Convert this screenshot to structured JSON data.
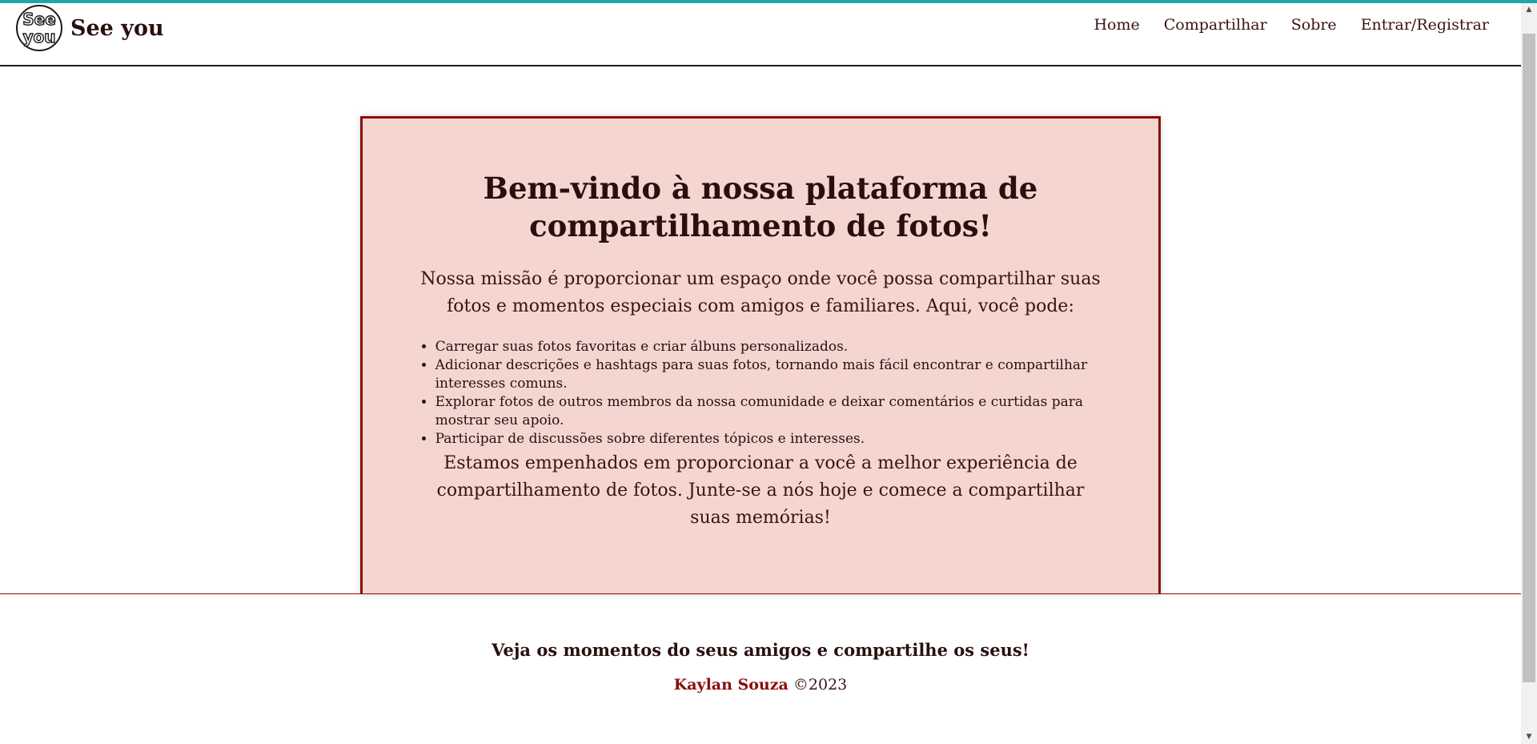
{
  "brand": {
    "name": "See you",
    "logo_text_top": "See",
    "logo_text_bottom": "you"
  },
  "nav": {
    "items": [
      "Home",
      "Compartilhar",
      "Sobre",
      "Entrar/Registrar"
    ]
  },
  "colors": {
    "accent_bar": "#1fa7a7",
    "card_bg": "#f4d5d0",
    "card_border": "#8b0d0d",
    "text": "#3a1212"
  },
  "main": {
    "title": "Bem-vindo à nossa plataforma de compartilhamento de fotos!",
    "intro": "Nossa missão é proporcionar um espaço onde você possa compartilhar suas fotos e momentos especiais com amigos e familiares. Aqui, você pode:",
    "features": [
      "Carregar suas fotos favoritas e criar álbuns personalizados.",
      "Adicionar descrições e hashtags para suas fotos, tornando mais fácil encontrar e compartilhar interesses comuns.",
      "Explorar fotos de outros membros da nossa comunidade e deixar comentários e curtidas para mostrar seu apoio.",
      "Participar de discussões sobre diferentes tópicos e interesses."
    ],
    "outro": "Estamos empenhados em proporcionar a você a melhor experiência de compartilhamento de fotos. Junte-se a nós hoje e comece a compartilhar suas memórias!"
  },
  "footer": {
    "tagline": "Veja os momentos do seus amigos e compartilhe os seus!",
    "author": "Kaylan Souza",
    "copyright": "©2023"
  },
  "scrollbar": {
    "up_arrow": "▲",
    "down_arrow": "▼"
  }
}
